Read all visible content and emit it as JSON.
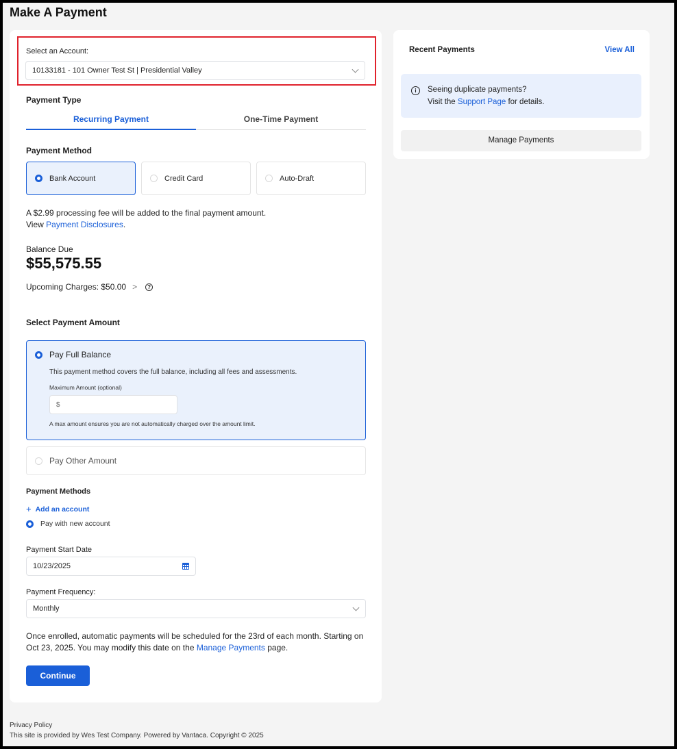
{
  "page": {
    "title": "Make A Payment"
  },
  "account": {
    "label": "Select an Account:",
    "selected": "10133181 - 101 Owner Test St | Presidential Valley"
  },
  "payment_type": {
    "label": "Payment Type",
    "tabs": [
      {
        "label": "Recurring Payment",
        "active": true
      },
      {
        "label": "One-Time Payment",
        "active": false
      }
    ]
  },
  "payment_method": {
    "label": "Payment Method",
    "options": [
      {
        "label": "Bank Account",
        "selected": true
      },
      {
        "label": "Credit Card",
        "selected": false
      },
      {
        "label": "Auto-Draft",
        "selected": false
      }
    ],
    "fee_text": "A $2.99 processing fee will be added to the final payment amount.",
    "disclosure_prefix": "View ",
    "disclosure_link": "Payment Disclosures",
    "disclosure_suffix": "."
  },
  "balance": {
    "label": "Balance Due",
    "amount": "$55,575.55",
    "upcoming": "Upcoming Charges: $50.00",
    "chevron": ">",
    "help_glyph": "?"
  },
  "amount": {
    "label": "Select Payment Amount",
    "full": {
      "title": "Pay Full Balance",
      "description": "This payment method covers the full balance, including all fees and assessments.",
      "max_label": "Maximum Amount (optional)",
      "max_placeholder": "$",
      "hint": "A max amount ensures you are not automatically charged over the amount limit."
    },
    "other": {
      "title": "Pay Other Amount"
    }
  },
  "payment_methods": {
    "label": "Payment Methods",
    "add_plus": "+",
    "add_label": "Add an account",
    "new_account_label": "Pay with new account"
  },
  "start_date": {
    "label": "Payment Start Date",
    "value": "10/23/2025"
  },
  "frequency": {
    "label": "Payment Frequency:",
    "value": "Monthly"
  },
  "schedule": {
    "line1": "Once enrolled, automatic payments will be scheduled for the 23rd of each month. Starting on",
    "line2_prefix": "Oct 23, 2025. You may modify this date on the ",
    "line2_link": "Manage Payments",
    "line2_suffix": " page."
  },
  "continue_label": "Continue",
  "recent": {
    "title": "Recent Payments",
    "view_all": "View All",
    "notice_title": "Seeing duplicate payments?",
    "notice_prefix": "Visit the ",
    "notice_link": "Support Page",
    "notice_suffix": " for details.",
    "info_glyph": "i",
    "manage_label": "Manage Payments"
  },
  "footer": {
    "privacy": "Privacy Policy",
    "copyright": "This site is provided by Wes Test Company. Powered by Vantaca. Copyright © 2025"
  },
  "colors": {
    "accent": "#1a5fd8",
    "highlight_border": "#e0212b",
    "selected_bg": "#eaf1fc"
  }
}
